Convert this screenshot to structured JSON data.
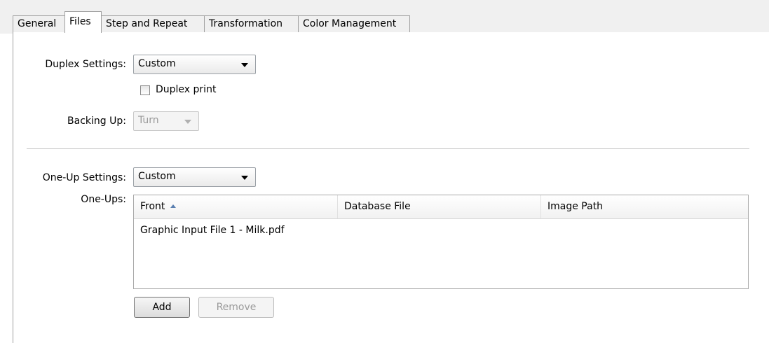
{
  "tabs": [
    {
      "label": "General"
    },
    {
      "label": "Files"
    },
    {
      "label": "Step and Repeat"
    },
    {
      "label": "Transformation"
    },
    {
      "label": "Color Management"
    }
  ],
  "active_tab": "Files",
  "duplex": {
    "label": "Duplex Settings:",
    "value": "Custom",
    "checkbox_label": "Duplex print",
    "checked": false
  },
  "backing_up": {
    "label": "Backing Up:",
    "value": "Turn",
    "disabled": true
  },
  "oneup": {
    "label": "One-Up Settings:",
    "value": "Custom"
  },
  "oneups": {
    "label": "One-Ups:",
    "columns": [
      "Front",
      "Database File",
      "Image Path"
    ],
    "sorted_column": "Front",
    "rows": [
      {
        "front": "Graphic Input File 1 - Milk.pdf",
        "database_file": "",
        "image_path": ""
      }
    ]
  },
  "buttons": {
    "add": "Add",
    "remove": "Remove"
  }
}
